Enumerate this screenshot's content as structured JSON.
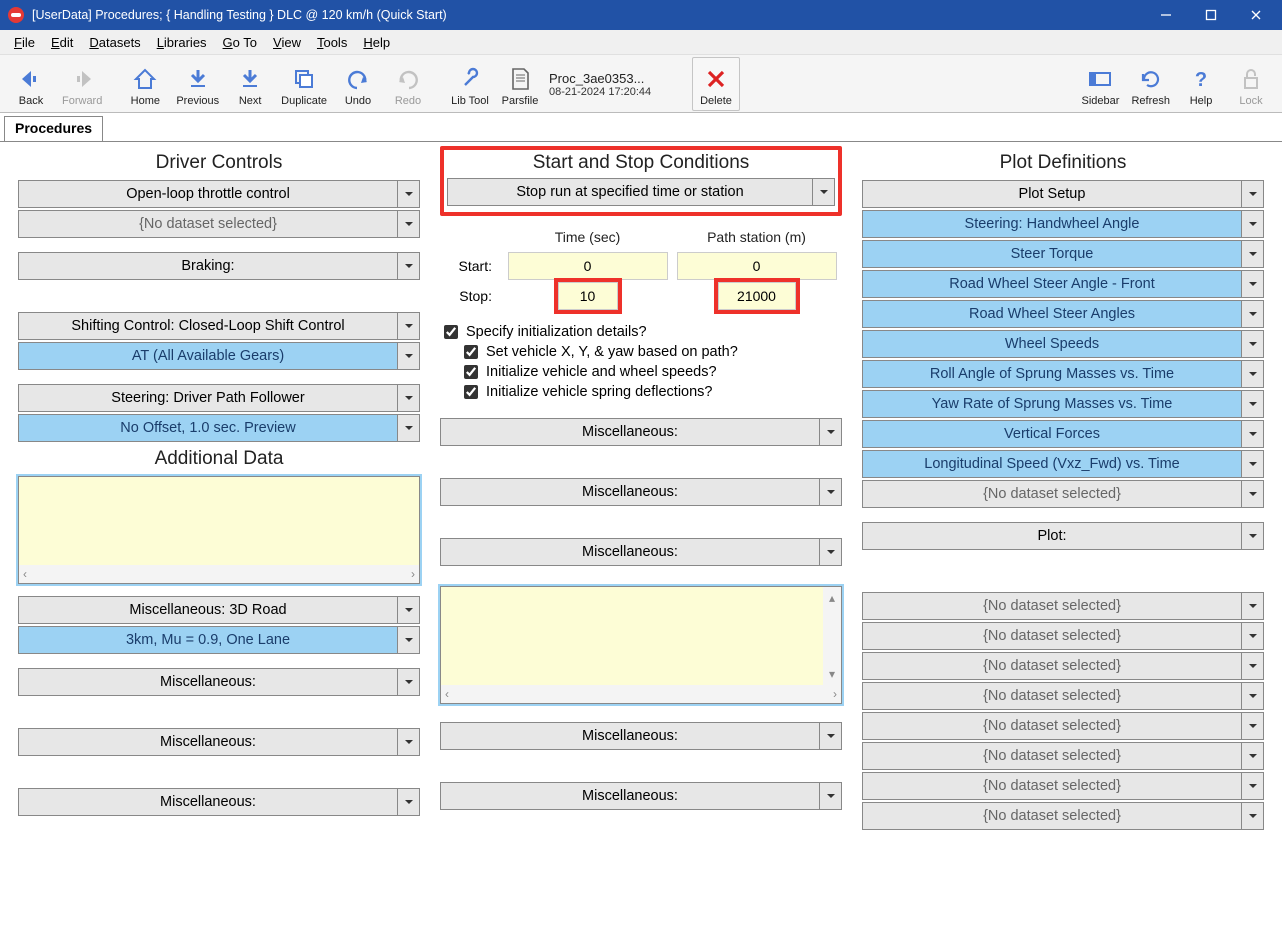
{
  "window": {
    "title": "[UserData] Procedures; { Handling Testing } DLC @ 120 km/h (Quick Start)"
  },
  "menu": {
    "items": [
      "File",
      "Edit",
      "Datasets",
      "Libraries",
      "Go To",
      "View",
      "Tools",
      "Help"
    ]
  },
  "toolbar": {
    "back": "Back",
    "forward": "Forward",
    "home": "Home",
    "previous": "Previous",
    "next": "Next",
    "duplicate": "Duplicate",
    "undo": "Undo",
    "redo": "Redo",
    "libtool": "Lib Tool",
    "parsfile": "Parsfile",
    "parsfile_name": "Proc_3ae0353...",
    "parsfile_ts": "08-21-2024 17:20:44",
    "delete": "Delete",
    "sidebar": "Sidebar",
    "refresh": "Refresh",
    "help": "Help",
    "lock": "Lock"
  },
  "tab": {
    "label": "Procedures"
  },
  "driver": {
    "title": "Driver Controls",
    "throttle": "Open-loop throttle control",
    "throttle_sub": "{No dataset selected}",
    "braking": "Braking:",
    "shift": "Shifting Control: Closed-Loop Shift Control",
    "shift_sub": "AT (All Available Gears)",
    "steer": "Steering: Driver Path Follower",
    "steer_sub": "No Offset, 1.0 sec. Preview",
    "additional_title": "Additional Data",
    "m3d": "Miscellaneous: 3D Road",
    "m3d_sub": "3km, Mu = 0.9, One Lane",
    "misc": "Miscellaneous:"
  },
  "startstop": {
    "title": "Start and Stop Conditions",
    "stoprun": "Stop run at specified time or station",
    "time_hdr": "Time (sec)",
    "path_hdr": "Path station (m)",
    "start_lbl": "Start:",
    "stop_lbl": "Stop:",
    "start_time": "0",
    "start_path": "0",
    "stop_time": "10",
    "stop_path": "21000",
    "spec_init": "Specify initialization details?",
    "init_xy": "Set vehicle X, Y, & yaw based on path?",
    "init_spd": "Initialize vehicle and wheel speeds?",
    "init_sd": "Initialize vehicle spring deflections?",
    "misc": "Miscellaneous:"
  },
  "plots": {
    "title": "Plot Definitions",
    "setup": "Plot Setup",
    "items": [
      "Steering: Handwheel Angle",
      "Steer Torque",
      "Road Wheel Steer Angle - Front",
      "Road Wheel Steer Angles",
      "Wheel Speeds",
      "Roll Angle of Sprung Masses vs. Time",
      "Yaw Rate of Sprung Masses vs. Time",
      "Vertical Forces",
      "Longitudinal Speed (Vxz_Fwd) vs. Time"
    ],
    "nosel": "{No dataset selected}",
    "plot_lbl": "Plot:"
  }
}
